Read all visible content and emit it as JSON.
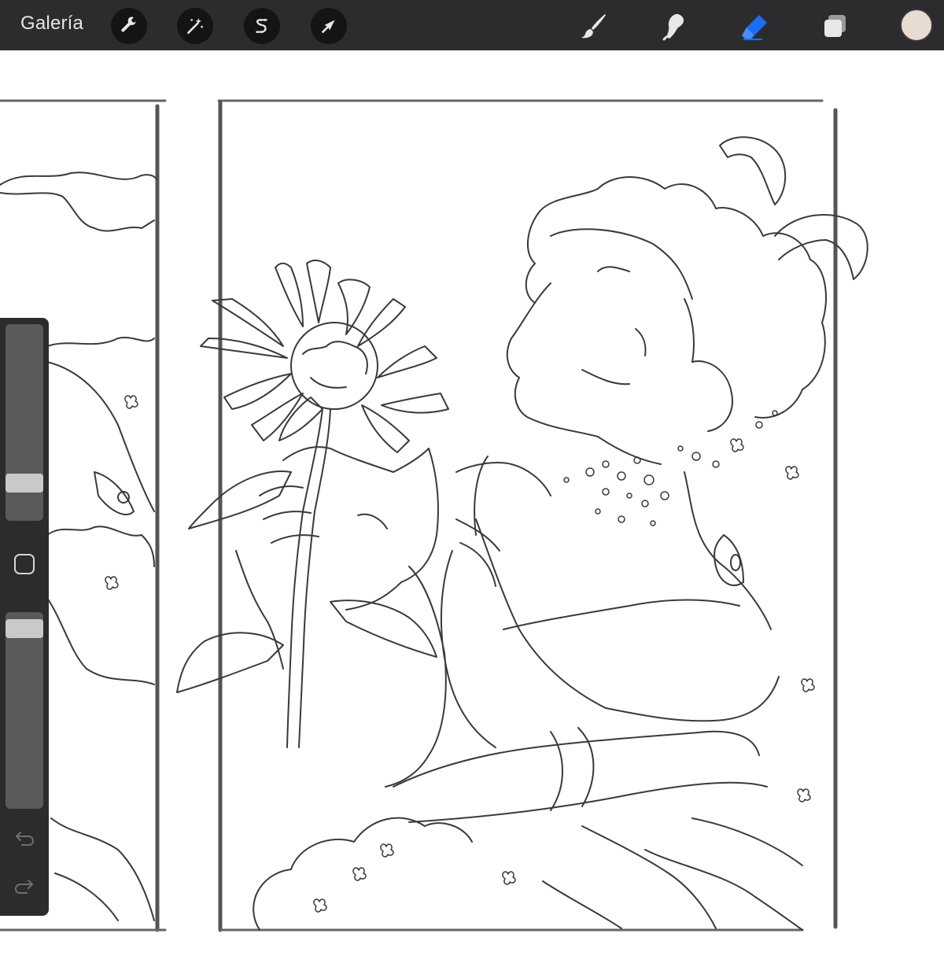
{
  "topbar": {
    "gallery_label": "Galería",
    "left_tools": [
      {
        "name": "actions-wrench-icon"
      },
      {
        "name": "adjustments-magic-wand-icon"
      },
      {
        "name": "selection-s-icon"
      },
      {
        "name": "transform-arrow-icon"
      }
    ],
    "right_tools": [
      {
        "name": "brush-icon",
        "active": false
      },
      {
        "name": "smudge-icon",
        "active": false
      },
      {
        "name": "eraser-icon",
        "active": true
      },
      {
        "name": "layers-icon",
        "active": false
      }
    ],
    "accent_color": "#1a6ef5",
    "current_color": "#e8dcd2"
  },
  "sidebar": {
    "brush_size_level": 0.16,
    "opacity_level": 0.96
  }
}
